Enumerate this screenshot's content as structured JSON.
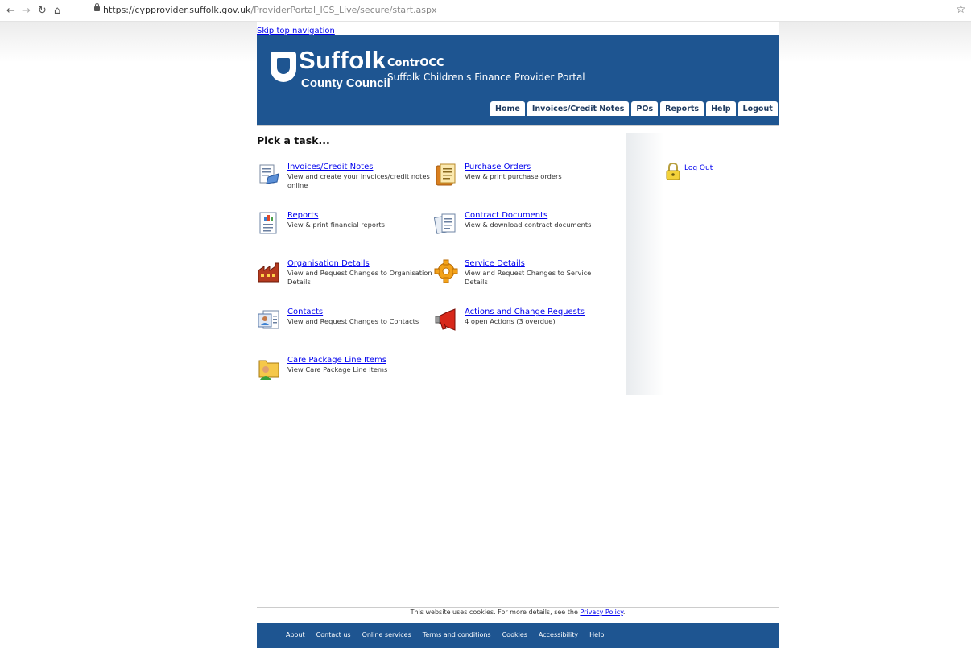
{
  "browser": {
    "url_host": "https://cypprovider.suffolk.gov.uk",
    "url_path": "/ProviderPortal_ICS_Live/secure/start.aspx"
  },
  "header": {
    "skip_link": "Skip top navigation",
    "logo_line1": "Suffolk",
    "logo_line2": "County Council",
    "brand_title": "ContrOCC",
    "brand_subtitle": "Suffolk Children's Finance Provider Portal",
    "tabs": [
      "Home",
      "Invoices/Credit Notes",
      "POs",
      "Reports",
      "Help",
      "Logout"
    ]
  },
  "main": {
    "heading": "Pick a task...",
    "tasks": [
      {
        "title": "Invoices/Credit Notes",
        "desc": "View and create your invoices/credit notes online",
        "icon": "invoice-icon"
      },
      {
        "title": "Purchase Orders",
        "desc": "View & print purchase orders",
        "icon": "purchase-order-icon"
      },
      {
        "title": "Reports",
        "desc": "View & print financial reports",
        "icon": "report-icon"
      },
      {
        "title": "Contract Documents",
        "desc": "View & download contract documents",
        "icon": "contract-documents-icon"
      },
      {
        "title": "Organisation Details",
        "desc": "View and Request Changes to Organisation Details",
        "icon": "organisation-icon"
      },
      {
        "title": "Service Details",
        "desc": "View and Request Changes to Service Details",
        "icon": "service-gear-icon"
      },
      {
        "title": "Contacts",
        "desc": "View and Request Changes to Contacts",
        "icon": "contacts-card-icon"
      },
      {
        "title": "Actions and Change Requests",
        "desc": "4 open Actions (3 overdue)",
        "icon": "megaphone-icon"
      },
      {
        "title": "Care Package Line Items",
        "desc": "View Care Package Line Items",
        "icon": "care-package-icon"
      }
    ]
  },
  "sidebar": {
    "logout_label": "Log Out"
  },
  "footer": {
    "cookie_text": "This website uses cookies. For more details, see the",
    "cookie_link": "Privacy Policy",
    "cookie_end": ".",
    "links": [
      "About",
      "Contact us",
      "Online services",
      "Terms and conditions",
      "Cookies",
      "Accessibility",
      "Help"
    ]
  },
  "colors": {
    "banner": "#1e5591",
    "link": "#0000ee"
  }
}
